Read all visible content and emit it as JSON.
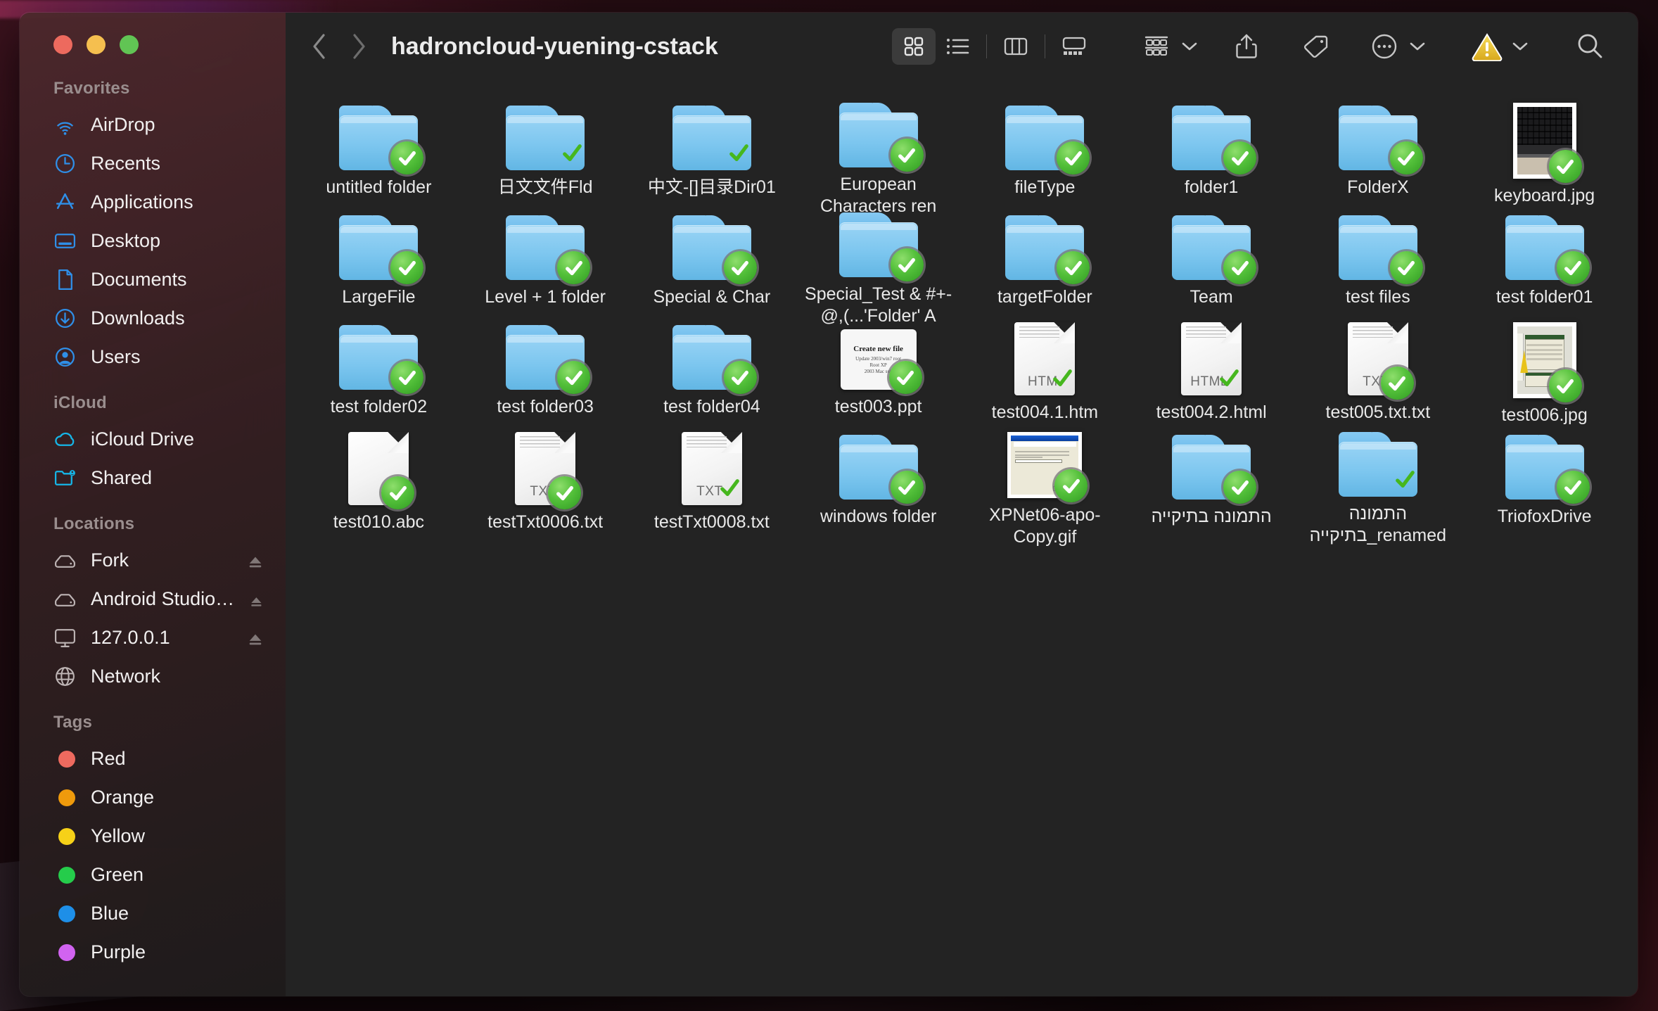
{
  "window": {
    "title": "hadroncloud-yuening-cstack",
    "traffic_lights": [
      "close",
      "minimize",
      "zoom"
    ]
  },
  "toolbar": {
    "back_label": "Back",
    "forward_label": "Forward",
    "view_modes": [
      {
        "id": "icon",
        "label": "Icon View",
        "active": true
      },
      {
        "id": "list",
        "label": "List View",
        "active": false
      },
      {
        "id": "column",
        "label": "Column View",
        "active": false
      },
      {
        "id": "gallery",
        "label": "Gallery View",
        "active": false
      }
    ],
    "group_label": "Group",
    "share_label": "Share",
    "tag_label": "Tags",
    "more_label": "More",
    "warning_label": "Warning",
    "search_label": "Search"
  },
  "sidebar": {
    "sections": [
      {
        "title": "Favorites",
        "items": [
          {
            "label": "AirDrop",
            "icon": "airdrop-icon",
            "eject": false
          },
          {
            "label": "Recents",
            "icon": "clock-icon",
            "eject": false
          },
          {
            "label": "Applications",
            "icon": "applications-icon",
            "eject": false
          },
          {
            "label": "Desktop",
            "icon": "desktop-icon",
            "eject": false
          },
          {
            "label": "Documents",
            "icon": "document-icon",
            "eject": false
          },
          {
            "label": "Downloads",
            "icon": "download-icon",
            "eject": false
          },
          {
            "label": "Users",
            "icon": "user-icon",
            "eject": false
          }
        ]
      },
      {
        "title": "iCloud",
        "items": [
          {
            "label": "iCloud Drive",
            "icon": "cloud-icon",
            "eject": false
          },
          {
            "label": "Shared",
            "icon": "shared-folder-icon",
            "eject": false
          }
        ]
      },
      {
        "title": "Locations",
        "items": [
          {
            "label": "Fork",
            "icon": "disk-icon",
            "eject": true
          },
          {
            "label": "Android Studio - B...",
            "icon": "disk-icon",
            "eject": true
          },
          {
            "label": "127.0.0.1",
            "icon": "monitor-icon",
            "eject": true
          },
          {
            "label": "Network",
            "icon": "globe-icon",
            "eject": false
          }
        ]
      },
      {
        "title": "Tags",
        "items": [
          {
            "label": "Red",
            "icon": "tag-dot",
            "color": "#ee6a5f",
            "eject": false
          },
          {
            "label": "Orange",
            "icon": "tag-dot",
            "color": "#ef9a0c",
            "eject": false
          },
          {
            "label": "Yellow",
            "icon": "tag-dot",
            "color": "#f6d118",
            "eject": false
          },
          {
            "label": "Green",
            "icon": "tag-dot",
            "color": "#25cc4b",
            "eject": false
          },
          {
            "label": "Blue",
            "icon": "tag-dot",
            "color": "#1e8fe8",
            "eject": false
          },
          {
            "label": "Purple",
            "icon": "tag-dot",
            "color": "#d163f0",
            "eject": false
          }
        ]
      }
    ]
  },
  "files": [
    {
      "name": "untitled folder",
      "kind": "folder",
      "badge": "check-circle"
    },
    {
      "name": "日文文件Fld",
      "kind": "folder",
      "badge": "check-plain"
    },
    {
      "name": "中文-[]目录Dir01",
      "kind": "folder",
      "badge": "check-plain"
    },
    {
      "name": "European Characters ren",
      "kind": "folder",
      "badge": "check-circle"
    },
    {
      "name": "fileType",
      "kind": "folder",
      "badge": "check-circle"
    },
    {
      "name": "folder1",
      "kind": "folder",
      "badge": "check-circle"
    },
    {
      "name": "FolderX",
      "kind": "folder",
      "badge": "check-circle"
    },
    {
      "name": "keyboard.jpg",
      "kind": "photo-keyboard",
      "badge": "check-circle"
    },
    {
      "name": "LargeFile",
      "kind": "folder",
      "badge": "check-circle"
    },
    {
      "name": "Level + 1 folder",
      "kind": "folder",
      "badge": "check-circle"
    },
    {
      "name": "Special & Char",
      "kind": "folder",
      "badge": "check-circle"
    },
    {
      "name": "Special_Test & #+-@,(...'Folder' A",
      "kind": "folder",
      "badge": "check-circle"
    },
    {
      "name": "targetFolder",
      "kind": "folder",
      "badge": "check-circle"
    },
    {
      "name": "Team",
      "kind": "folder",
      "badge": "check-circle"
    },
    {
      "name": "test files",
      "kind": "folder",
      "badge": "check-circle"
    },
    {
      "name": "test folder01",
      "kind": "folder",
      "badge": "check-circle"
    },
    {
      "name": "test folder02",
      "kind": "folder",
      "badge": "check-circle"
    },
    {
      "name": "test folder03",
      "kind": "folder",
      "badge": "check-circle"
    },
    {
      "name": "test folder04",
      "kind": "folder",
      "badge": "check-circle"
    },
    {
      "name": "test003.ppt",
      "kind": "ppt",
      "badge": "check-circle",
      "preview_title": "Create new file",
      "preview_lines": [
        "Update 2003/win7 root",
        "Root XP",
        "2003 Mac sub"
      ]
    },
    {
      "name": "test004.1.htm",
      "kind": "doc",
      "ext": "HTM",
      "badge": "check-plain"
    },
    {
      "name": "test004.2.html",
      "kind": "doc",
      "ext": "HTML",
      "badge": "check-plain"
    },
    {
      "name": "test005.txt.txt",
      "kind": "doc",
      "ext": "TXT",
      "badge": "check-circle"
    },
    {
      "name": "test006.jpg",
      "kind": "photo-winshot",
      "badge": "check-circle"
    },
    {
      "name": "test010.abc",
      "kind": "doc",
      "ext": "",
      "badge": "check-circle"
    },
    {
      "name": "testTxt0006.txt",
      "kind": "doc",
      "ext": "TXT",
      "badge": "check-circle"
    },
    {
      "name": "testTxt0008.txt",
      "kind": "doc",
      "ext": "TXT",
      "badge": "check-plain"
    },
    {
      "name": "windows folder",
      "kind": "folder",
      "badge": "check-circle"
    },
    {
      "name": "XPNet06-apo-Copy.gif",
      "kind": "photo-xpshot",
      "badge": "check-circle"
    },
    {
      "name": "התמונה בתיקייה",
      "kind": "folder",
      "badge": "check-circle"
    },
    {
      "name": "התמונה בתיקייה_renamed",
      "kind": "folder",
      "badge": "check-plain"
    },
    {
      "name": "TriofoxDrive",
      "kind": "folder",
      "badge": "check-circle"
    }
  ]
}
